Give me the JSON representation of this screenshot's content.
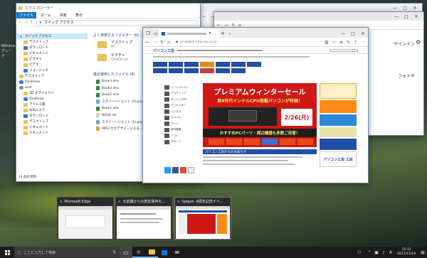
{
  "desktop": {
    "icon_label_line1": "Windows",
    "icon_label_line2": "グレード"
  },
  "explorer": {
    "title": "エクスプローラー",
    "ribbon_tabs": [
      "ファイル",
      "ホーム",
      "共有",
      "表示"
    ],
    "address": "クイック アクセス",
    "nav": [
      {
        "label": "クイック アクセス",
        "icon": "star-icon"
      },
      {
        "label": "デスクトップ",
        "icon": "folder-icon"
      },
      {
        "label": "ダウンロード",
        "icon": "download-icon"
      },
      {
        "label": "ドキュメント",
        "icon": "folder-icon"
      },
      {
        "label": "ピクチャ",
        "icon": "folder-icon"
      },
      {
        "label": "ビデオ",
        "icon": "folder-icon"
      },
      {
        "label": "ミュージック",
        "icon": "music-icon"
      },
      {
        "label": "デスクトップ",
        "icon": "folder-icon"
      },
      {
        "label": "OneDrive",
        "icon": "cloud-icon"
      },
      {
        "label": "user",
        "icon": "user-icon"
      },
      {
        "label": "3D オブジェクト",
        "icon": "folder-icon"
      },
      {
        "label": "OneDrive",
        "icon": "cloud-icon"
      },
      {
        "label": "アドレス帳",
        "icon": "folder-icon"
      },
      {
        "label": "お気に入り",
        "icon": "folder-icon"
      },
      {
        "label": "ダウンロード",
        "icon": "download-icon"
      },
      {
        "label": "デスクトップ",
        "icon": "folder-icon"
      },
      {
        "label": "ドキュメント",
        "icon": "folder-icon"
      },
      {
        "label": "ドキュメント",
        "icon": "folder-icon"
      }
    ],
    "frequent_header": "よく使用するフォルダー (6)",
    "frequent": [
      {
        "name": "デスクトップ",
        "sub": "PC"
      },
      {
        "name": "ピクチャ",
        "sub": "OneDrive"
      }
    ],
    "recent_header": "最近使用したファイル (8)",
    "recent_files": [
      "Book3.xlsx",
      "Book0.xlsx",
      "Book2.xlsx",
      "スクリーンショット (2).png",
      "Book1.xlsx",
      "Nellot.txt",
      "スクリーンショット (1).png",
      "MOO セカデザインによる..."
    ],
    "status": "14 個の項目"
  },
  "edge_back": {
    "signin": "サインイン",
    "text": "フォトギ"
  },
  "edge_front": {
    "address": "pc.watch.impress.co.jp",
    "site_name": "パソコン工房",
    "banner_title": "プレミアムウィンターセール",
    "banner_sub": "第8世代インテルCPU搭載パソコンが特価！",
    "banner_date": "2/26(月)",
    "banner_bottom": "おすすめPCパーツ・周辺機器も多数ご用意！",
    "side_list": [
      "ノートパソコン",
      "デスクトップ",
      "ゲーミングPC",
      "クリエイター",
      "ビジネス",
      "モバイル",
      "パーツ",
      "周辺機器",
      "ソフト",
      "サポート"
    ],
    "lower_banner": "パソコン工房からのお知らせ",
    "right_ad": "パソコン工房 工房"
  },
  "thumbnails": [
    {
      "title": "Microsoft Edge",
      "icon": "edge-icon"
    },
    {
      "title": "大前撮からの庶友掌命を...",
      "icon": "edge-icon"
    },
    {
      "title": "Spigen. 8周年記念イベ...",
      "icon": "edge-icon"
    }
  ],
  "taskbar": {
    "search_placeholder": "ここに入力して検索",
    "time": "15:12",
    "date": "2017/11/19",
    "ime": "A"
  }
}
